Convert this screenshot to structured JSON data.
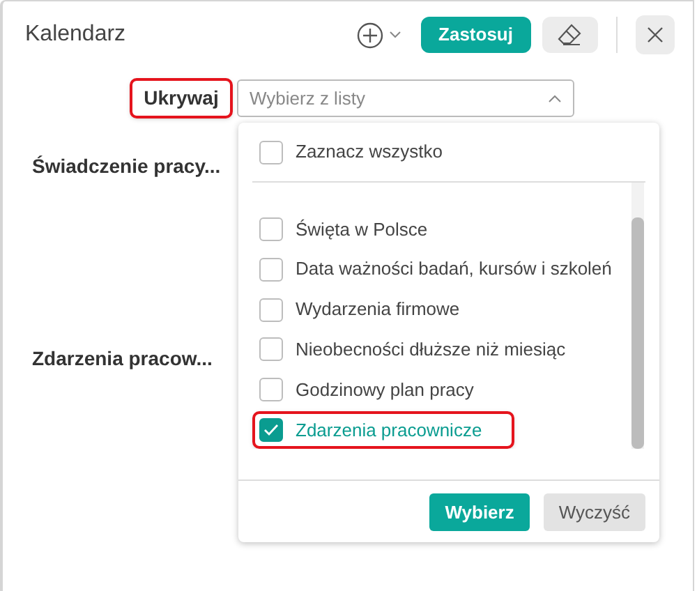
{
  "window": {
    "title": "Kalendarz"
  },
  "toolbar": {
    "apply": "Zastosuj"
  },
  "filter": {
    "label": "Ukrywaj",
    "highlighted": true,
    "placeholder": "Wybierz z listy",
    "expanded": true
  },
  "rows": [
    "Świadczenie pracy...",
    "Zdarzenia pracow..."
  ],
  "dropdown": {
    "select_all": {
      "label": "Zaznacz wszystko",
      "checked": false
    },
    "items": [
      {
        "label": "Święta w Polsce",
        "checked": false,
        "highlighted": false
      },
      {
        "label": "Data ważności badań, kursów i szkoleń",
        "checked": false,
        "highlighted": false
      },
      {
        "label": "Wydarzenia firmowe",
        "checked": false,
        "highlighted": false
      },
      {
        "label": "Nieobecności dłuższe niż miesiąc",
        "checked": false,
        "highlighted": false
      },
      {
        "label": "Godzinowy plan pracy",
        "checked": false,
        "highlighted": false
      },
      {
        "label": "Zdarzenia pracownicze",
        "checked": true,
        "highlighted": true
      }
    ],
    "buttons": [
      "Wybierz",
      "Wyczyść"
    ]
  }
}
